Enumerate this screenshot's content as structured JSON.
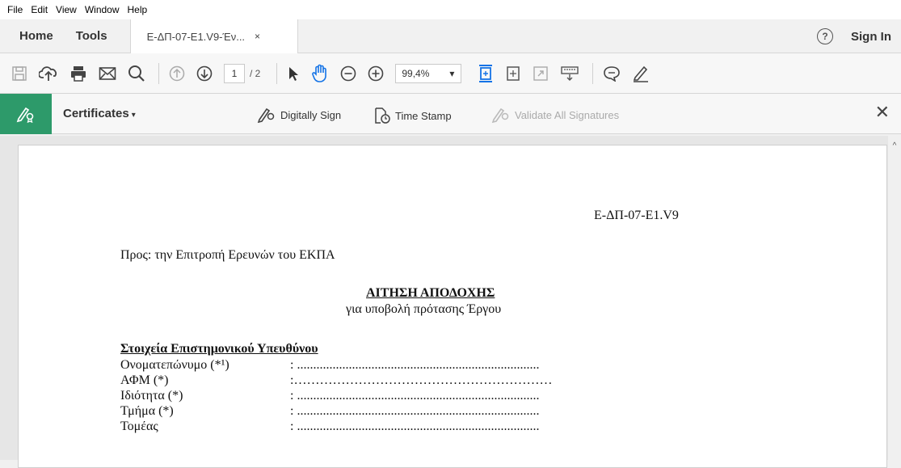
{
  "menu": [
    "File",
    "Edit",
    "View",
    "Window",
    "Help"
  ],
  "tabs": {
    "home": "Home",
    "tools": "Tools",
    "document": "Ε-ΔΠ-07-Ε1.V9-Έν...",
    "close": "×"
  },
  "header_right": {
    "help": "?",
    "sign_in": "Sign In"
  },
  "toolbar": {
    "page_current": "1",
    "page_total": "/ 2",
    "zoom": "99,4%",
    "zoom_caret": "▾"
  },
  "cert_toolbar": {
    "title": "Certificates",
    "caret": "▾",
    "digitally_sign": "Digitally Sign",
    "time_stamp": "Time Stamp",
    "validate_all": "Validate All Signatures",
    "close": "✕"
  },
  "scroll": {
    "up_arrow": "^"
  },
  "document": {
    "code": "Ε-ΔΠ-07-Ε1.V9",
    "to_line": "Προς:  την Επιτροπή Ερευνών του ΕΚΠΑ",
    "title": "ΑΙΤΗΣΗ ΑΠΟΔΟΧΗΣ",
    "subtitle": "για υποβολή πρότασης Έργου",
    "section_title": "Στοιχεία Επιστημονικού Υπευθύνου",
    "fields": [
      {
        "label": "Ονοματεπώνυμο (*¹)",
        "dots": ": ..........................................................................."
      },
      {
        "label": "ΑΦΜ (*)",
        "dots": ":……………………………………………………"
      },
      {
        "label": "Ιδιότητα (*)",
        "dots": ": ..........................................................................."
      },
      {
        "label": "Τμήμα (*)",
        "dots": ": ..........................................................................."
      },
      {
        "label": "Τομέας",
        "dots": ": ..........................................................................."
      }
    ]
  }
}
